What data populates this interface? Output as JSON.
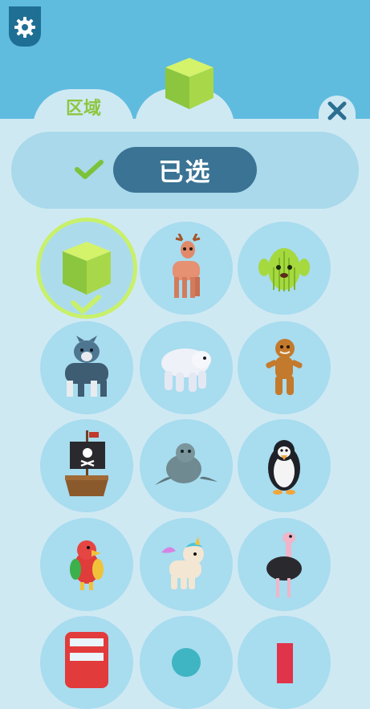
{
  "tabs": [
    {
      "label": "区域",
      "active": false
    },
    {
      "label": "",
      "icon": "green-cube-icon",
      "active": true
    }
  ],
  "selection": {
    "status_label": "已选",
    "check_icon": "checkmark-icon"
  },
  "items": [
    {
      "icon": "green-cube-icon",
      "selected": true
    },
    {
      "icon": "deer-icon",
      "selected": false
    },
    {
      "icon": "cactus-icon",
      "selected": false
    },
    {
      "icon": "wolf-icon",
      "selected": false
    },
    {
      "icon": "polar-bear-icon",
      "selected": false
    },
    {
      "icon": "gingerbread-man-icon",
      "selected": false
    },
    {
      "icon": "pirate-ship-icon",
      "selected": false
    },
    {
      "icon": "seal-icon",
      "selected": false
    },
    {
      "icon": "penguin-icon",
      "selected": false
    },
    {
      "icon": "parrot-icon",
      "selected": false
    },
    {
      "icon": "unicorn-icon",
      "selected": false
    },
    {
      "icon": "ostrich-icon",
      "selected": false
    },
    {
      "icon": "red-bus-icon",
      "selected": false
    },
    {
      "icon": "teal-ball-icon",
      "selected": false
    },
    {
      "icon": "red-block-icon",
      "selected": false
    }
  ],
  "colors": {
    "accent_green": "#8cc63f",
    "header_blue": "#5fbcdf",
    "panel": "#cfe9f3",
    "pill": "#3a7394",
    "selected_ring": "#c8f06a"
  }
}
